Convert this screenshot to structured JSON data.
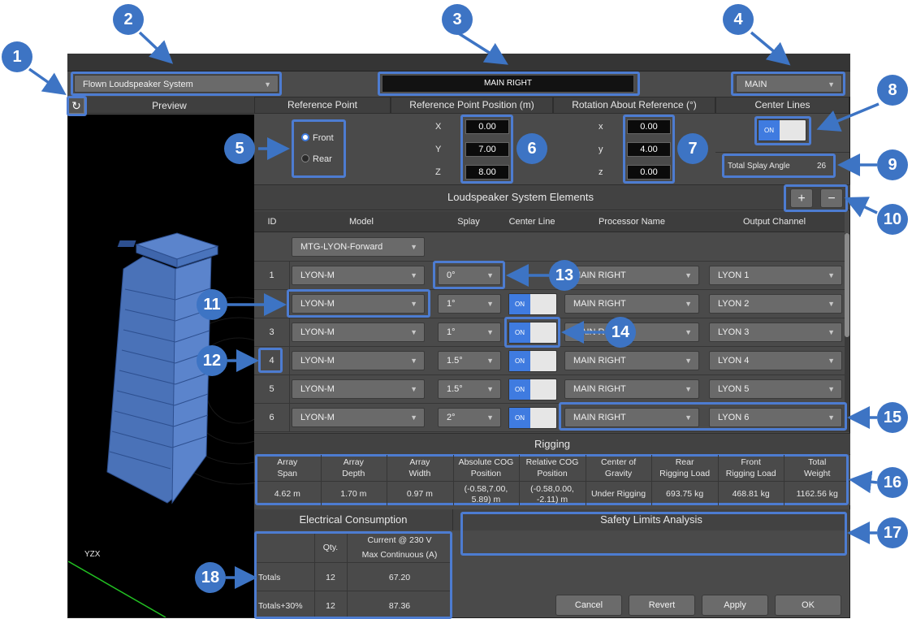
{
  "topbar": {
    "system_type": "Flown Loudspeaker System",
    "array_name": "MAIN RIGHT",
    "group": "MAIN"
  },
  "preview": {
    "title": "Preview",
    "axis_label": "YZX"
  },
  "reference_point": {
    "title": "Reference Point",
    "front": "Front",
    "rear": "Rear",
    "selected": "Front"
  },
  "ref_position": {
    "title": "Reference Point Position (m)",
    "x_label": "X",
    "y_label": "Y",
    "z_label": "Z",
    "x": "0.00",
    "y": "7.00",
    "z": "8.00"
  },
  "rotation": {
    "title": "Rotation About Reference (°)",
    "x_label": "x",
    "y_label": "y",
    "z_label": "z",
    "x": "0.00",
    "y": "4.00",
    "z": "0.00"
  },
  "center_lines": {
    "title": "Center Lines",
    "state": "ON"
  },
  "splay": {
    "label": "Total Splay Angle",
    "value": "26"
  },
  "elements": {
    "title": "Loudspeaker System Elements",
    "add": "+",
    "remove": "−",
    "headers": {
      "id": "ID",
      "model": "Model",
      "splay": "Splay",
      "center_line": "Center Line",
      "processor": "Processor Name",
      "output": "Output Channel"
    },
    "rigging_model": "MTG-LYON-Forward",
    "rows": [
      {
        "id": "1",
        "model": "LYON-M",
        "splay": "0°",
        "center": "",
        "processor": "MAIN RIGHT",
        "output": "LYON 1"
      },
      {
        "id": "2",
        "model": "LYON-M",
        "splay": "1°",
        "center": "ON",
        "processor": "MAIN RIGHT",
        "output": "LYON 2"
      },
      {
        "id": "3",
        "model": "LYON-M",
        "splay": "1°",
        "center": "ON",
        "processor": "MAIN RIGHT",
        "output": "LYON 3"
      },
      {
        "id": "4",
        "model": "LYON-M",
        "splay": "1.5°",
        "center": "ON",
        "processor": "MAIN RIGHT",
        "output": "LYON 4"
      },
      {
        "id": "5",
        "model": "LYON-M",
        "splay": "1.5°",
        "center": "ON",
        "processor": "MAIN RIGHT",
        "output": "LYON 5"
      },
      {
        "id": "6",
        "model": "LYON-M",
        "splay": "2°",
        "center": "ON",
        "processor": "MAIN RIGHT",
        "output": "LYON 6"
      }
    ]
  },
  "rigging": {
    "title": "Rigging",
    "cols": [
      {
        "h1": "Array",
        "h2": "Span",
        "v1": "4.62 m",
        "v2": ""
      },
      {
        "h1": "Array",
        "h2": "Depth",
        "v1": "1.70 m",
        "v2": ""
      },
      {
        "h1": "Array",
        "h2": "Width",
        "v1": "0.97 m",
        "v2": ""
      },
      {
        "h1": "Absolute COG",
        "h2": "Position",
        "v1": "(-0.58,7.00,",
        "v2": "5.89) m"
      },
      {
        "h1": "Relative COG",
        "h2": "Position",
        "v1": "(-0.58,0.00,",
        "v2": "-2.11) m"
      },
      {
        "h1": "Center of",
        "h2": "Gravity",
        "v1": "Under Rigging",
        "v2": ""
      },
      {
        "h1": "Rear",
        "h2": "Rigging Load",
        "v1": "693.75 kg",
        "v2": ""
      },
      {
        "h1": "Front",
        "h2": "Rigging Load",
        "v1": "468.81 kg",
        "v2": ""
      },
      {
        "h1": "Total",
        "h2": "Weight",
        "v1": "1162.56 kg",
        "v2": ""
      }
    ]
  },
  "electrical": {
    "title": "Electrical Consumption",
    "qty_header": "Qty.",
    "current_header1": "Current @ 230 V",
    "current_header2": "Max Continuous (A)",
    "rows": [
      {
        "label": "Totals",
        "qty": "12",
        "current": "67.20"
      },
      {
        "label": "Totals+30%",
        "qty": "12",
        "current": "87.36"
      }
    ]
  },
  "safety": {
    "title": "Safety Limits Analysis"
  },
  "buttons": {
    "cancel": "Cancel",
    "revert": "Revert",
    "apply": "Apply",
    "ok": "OK"
  },
  "callouts": [
    "1",
    "2",
    "3",
    "4",
    "5",
    "6",
    "7",
    "8",
    "9",
    "10",
    "11",
    "12",
    "13",
    "14",
    "15",
    "16",
    "17",
    "18"
  ],
  "colors": {
    "callout": "#3d74c4",
    "toggle_on": "#3f7be0",
    "speaker": "#4a72b8"
  }
}
